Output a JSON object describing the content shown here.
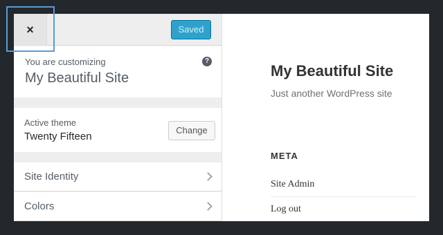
{
  "header": {
    "close_glyph": "×",
    "saved_label": "Saved"
  },
  "info": {
    "prefix": "You are customizing",
    "site_name": "My Beautiful Site",
    "help_glyph": "?"
  },
  "theme": {
    "label": "Active theme",
    "name": "Twenty Fifteen",
    "change_label": "Change"
  },
  "sections": [
    {
      "label": "Site Identity"
    },
    {
      "label": "Colors"
    }
  ],
  "preview": {
    "site_title": "My Beautiful Site",
    "tagline": "Just another WordPress site",
    "widget_title": "META",
    "links": [
      "Site Admin",
      "Log out"
    ]
  },
  "colors": {
    "accent": "#2ea2cc",
    "highlight": "#5a9ad6",
    "backdrop": "#23282d"
  }
}
